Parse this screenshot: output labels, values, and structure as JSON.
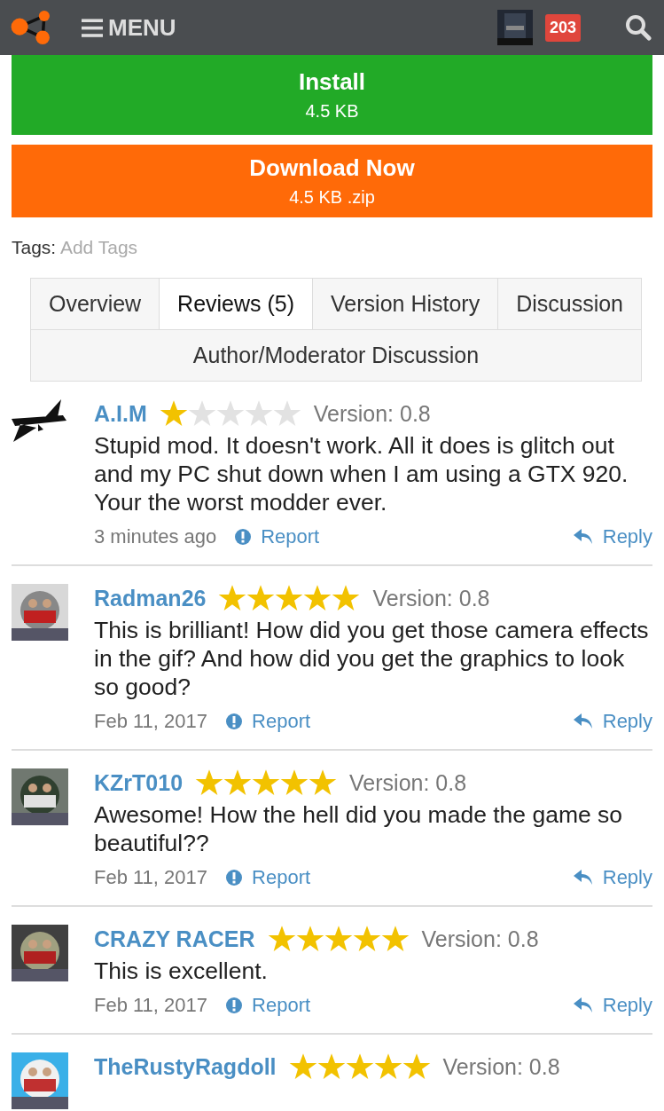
{
  "header": {
    "menu_label": "MENU",
    "notification_count": "203"
  },
  "install": {
    "label": "Install",
    "size": "4.5 KB"
  },
  "download": {
    "label": "Download Now",
    "size": "4.5 KB .zip"
  },
  "tags": {
    "label": "Tags:",
    "link": "Add Tags"
  },
  "tabs": [
    {
      "label": "Overview",
      "selected": false
    },
    {
      "label": "Reviews (5)",
      "selected": true
    },
    {
      "label": "Version History",
      "selected": false
    },
    {
      "label": "Discussion",
      "selected": false
    },
    {
      "label": "Author/Moderator Discussion",
      "selected": false
    }
  ],
  "reviews": [
    {
      "kind": "icon",
      "author": "A.I.M",
      "stars": 1,
      "version": "Version: 0.8",
      "text": "Stupid mod. It doesn't work. All it does is glitch out and my PC shut down when I am using a GTX 920. Your the worst modder ever.",
      "time": "3 minutes ago",
      "report": "Report",
      "reply": "Reply"
    },
    {
      "kind": "picture",
      "author": "Radman26",
      "stars": 5,
      "version": "Version: 0.8",
      "text": "This is brilliant! How did you get those camera effects in the gif? And how did you get the graphics to look so good?",
      "time": "Feb 11, 2017",
      "report": "Report",
      "reply": "Reply"
    },
    {
      "kind": "picture",
      "author": "KZrT010",
      "stars": 5,
      "version": "Version: 0.8",
      "text": "Awesome! How the hell did you made the game so beautiful??",
      "time": "Feb 11, 2017",
      "report": "Report",
      "reply": "Reply"
    },
    {
      "kind": "picture",
      "author": "CRAZY RACER",
      "stars": 5,
      "version": "Version: 0.8",
      "text": "This is excellent.",
      "time": "Feb 11, 2017",
      "report": "Report",
      "reply": "Reply"
    },
    {
      "kind": "picture",
      "author": "TheRustyRagdoll",
      "stars": 5,
      "version": "Version: 0.8"
    }
  ]
}
